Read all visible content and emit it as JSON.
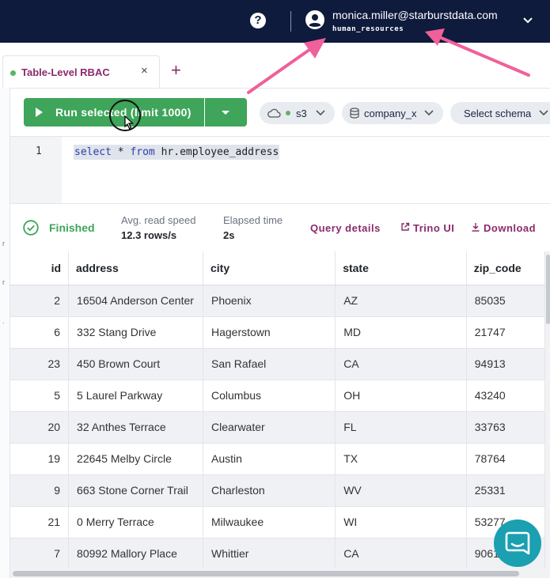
{
  "header": {
    "help_icon": "help-circle-icon",
    "user_icon": "account-circle-icon",
    "user_email": "monica.miller@starburstdata.com",
    "user_role": "human_resources",
    "bg_color": "#0f1b3d"
  },
  "tabs": [
    {
      "label": "Table-Level RBAC",
      "status_color": "#5ab56a",
      "active": true
    }
  ],
  "tab_close": "×",
  "tab_add": "+",
  "toolbar": {
    "run_label": "Run selected (limit 1000)",
    "catalog": "s3",
    "database": "company_x",
    "schema_placeholder": "Select schema",
    "accent_green": "#3ea55a"
  },
  "editor": {
    "line_number": "1",
    "code_keyword_select": "select",
    "code_star": " * ",
    "code_keyword_from": "from",
    "code_table": " hr.employee_address"
  },
  "status": {
    "state": "Finished",
    "read_speed_label": "Avg. read speed",
    "read_speed_value": "12.3 rows/s",
    "elapsed_label": "Elapsed time",
    "elapsed_value": "2s",
    "query_details": "Query details",
    "trino_ui": "Trino UI",
    "download": "Download"
  },
  "table": {
    "columns": [
      "id",
      "address",
      "city",
      "state",
      "zip_code"
    ],
    "rows": [
      [
        "2",
        "16504 Anderson Center",
        "Phoenix",
        "AZ",
        "85035"
      ],
      [
        "6",
        "332 Stang Drive",
        "Hagerstown",
        "MD",
        "21747"
      ],
      [
        "23",
        "450 Brown Court",
        "San Rafael",
        "CA",
        "94913"
      ],
      [
        "5",
        "5 Laurel Parkway",
        "Columbus",
        "OH",
        "43240"
      ],
      [
        "20",
        "32 Anthes Terrace",
        "Clearwater",
        "FL",
        "33763"
      ],
      [
        "19",
        "22645 Melby Circle",
        "Austin",
        "TX",
        "78764"
      ],
      [
        "9",
        "663 Stone Corner Trail",
        "Charleston",
        "WV",
        "25331"
      ],
      [
        "21",
        "0 Merry Terrace",
        "Milwaukee",
        "WI",
        "53277"
      ],
      [
        "7",
        "80992 Mallory Place",
        "Whittier",
        "CA",
        "90610"
      ]
    ]
  },
  "chat_icon": "chat-bubble-icon",
  "annotation_color": "#f0609a"
}
